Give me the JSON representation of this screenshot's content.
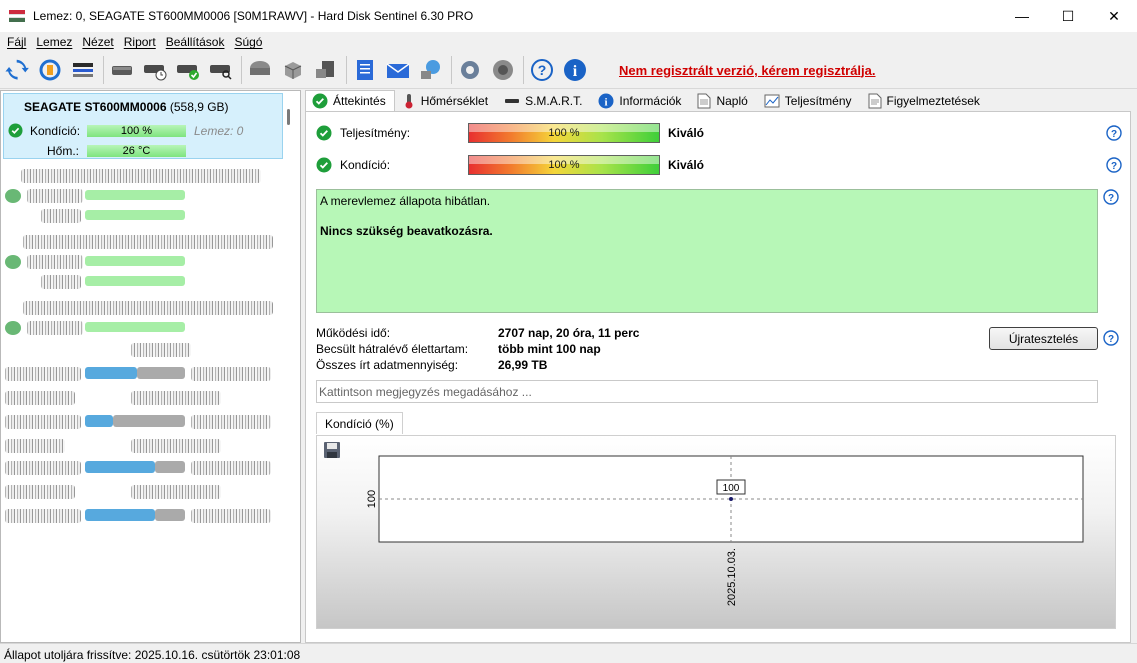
{
  "window": {
    "title": "Lemez: 0, SEAGATE ST600MM0006 [S0M1RAWV]  -  Hard Disk Sentinel 6.30 PRO",
    "min_glyph": "—",
    "max_glyph": "☐",
    "close_glyph": "✕"
  },
  "menu": [
    "Fájl",
    "Lemez",
    "Nézet",
    "Riport",
    "Beállítások",
    "Súgó"
  ],
  "toolbar": {
    "registration_warning": "Nem regisztrált verzió, kérem regisztrálja.",
    "icons": [
      "refresh-icon",
      "refresh-warning-icon",
      "disk-list-icon",
      "disk-icon",
      "disk-clock-icon",
      "disk-check-icon",
      "disk-search-icon",
      "drive-icon",
      "cube-icon",
      "server-icon",
      "notes-icon",
      "mail-icon",
      "network-icon",
      "settings-gear-icon",
      "speaker-icon",
      "help-icon",
      "info-icon"
    ]
  },
  "disk_panel": {
    "selected": {
      "name": "SEAGATE ST600MM0006",
      "size": "(558,9 GB)",
      "condition_label": "Kondíció:",
      "condition_value": "100 %",
      "condition_percent": 100,
      "extra": "Lemez: 0",
      "temp_label": "Hőm.:",
      "temp_value": "26 °C"
    }
  },
  "tabs": [
    {
      "label": "Áttekintés",
      "icon": "check-circle-icon",
      "active": true
    },
    {
      "label": "Hőmérséklet",
      "icon": "thermometer-icon",
      "active": false
    },
    {
      "label": "S.M.A.R.T.",
      "icon": "disk-icon",
      "active": false
    },
    {
      "label": "Információk",
      "icon": "info-icon",
      "active": false
    },
    {
      "label": "Napló",
      "icon": "document-icon",
      "active": false
    },
    {
      "label": "Teljesítmény",
      "icon": "performance-chart-icon",
      "active": false
    },
    {
      "label": "Figyelmeztetések",
      "icon": "warning-list-icon",
      "active": false
    }
  ],
  "overview": {
    "performance": {
      "label": "Teljesítmény:",
      "value": "100 %",
      "percent": 100,
      "status": "Kiváló"
    },
    "condition": {
      "label": "Kondíció:",
      "value": "100 %",
      "percent": 100,
      "status": "Kiváló"
    },
    "status_text_line1": "A merevlemez állapota hibátlan.",
    "status_text_line2": "Nincs szükség beavatkozásra.",
    "power_on_label": "Működési idő:",
    "power_on_value": "2707 nap, 20 óra, 11 perc",
    "lifetime_label": "Becsült hátralévő élettartam:",
    "lifetime_value": "több mint 100 nap",
    "written_label": "Összes írt adatmennyiség:",
    "written_value": "26,99 TB",
    "retest_button": "Újratesztelés",
    "note_placeholder": "Kattintson megjegyzés megadásához ...",
    "chart_tab_label": "Kondíció  (%)"
  },
  "chart_data": {
    "type": "line",
    "x": [
      "2025.10.03."
    ],
    "series": [
      {
        "values": [
          100
        ]
      }
    ],
    "point_labels": [
      "100"
    ],
    "yticks": [
      "100"
    ]
  },
  "status_bar": "Állapot utoljára frissítve: 2025.10.16. csütörtök 23:01:08"
}
